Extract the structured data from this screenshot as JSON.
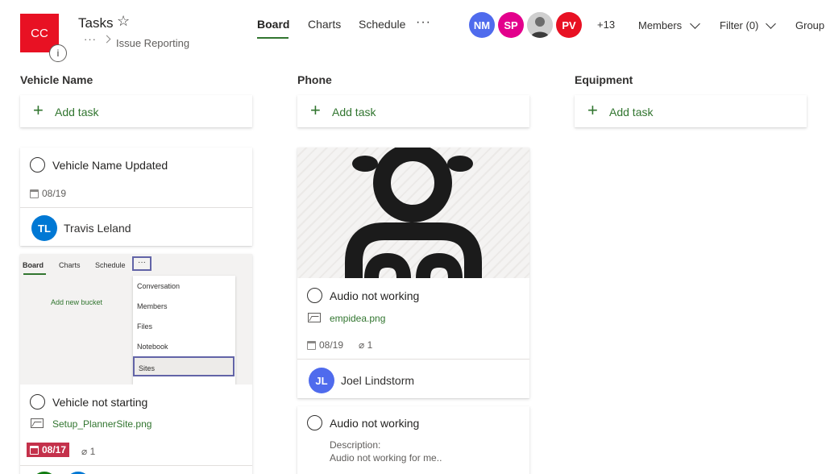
{
  "header": {
    "app_initials": "CC",
    "info_glyph": "i",
    "plan_title": "Tasks",
    "star_glyph": "☆",
    "breadcrumb_more": "···",
    "breadcrumb_label": "Issue Reporting",
    "tabs": [
      {
        "label": "Board",
        "active": true
      },
      {
        "label": "Charts",
        "active": false
      },
      {
        "label": "Schedule",
        "active": false
      }
    ],
    "tab_more": "···",
    "avatars": [
      {
        "initials": "NM",
        "color": "#4f6bed"
      },
      {
        "initials": "SP",
        "color": "#e3008c"
      },
      {
        "initials": "",
        "color": "#d0d0d0"
      },
      {
        "initials": "PV",
        "color": "#e81123"
      }
    ],
    "extra_members": "+13",
    "members_label": "Members",
    "filter_label": "Filter (0)",
    "group_label": "Group"
  },
  "buckets": [
    {
      "title": "Vehicle Name",
      "add_task": "Add task"
    },
    {
      "title": "Phone",
      "add_task": "Add task"
    },
    {
      "title": "Equipment",
      "add_task": "Add task"
    }
  ],
  "add_icon": "+",
  "cards": {
    "vehicle_updated": {
      "title": "Vehicle Name Updated",
      "date": "08/19",
      "assignee_initials": "TL",
      "assignee_name": "Travis Leland",
      "assignee_color": "#0078d4"
    },
    "vehicle_not_starting": {
      "preview": {
        "tabs": [
          "Board",
          "Charts",
          "Schedule"
        ],
        "more": "···",
        "add_bucket": "Add new bucket",
        "menu": [
          "Conversation",
          "Members",
          "Files",
          "Notebook",
          "Sites"
        ]
      },
      "title": "Vehicle not starting",
      "attachment": "Setup_PlannerSite.png",
      "date": "08/17",
      "date_color": "#c4314b",
      "attachment_count": "1"
    },
    "audio_1": {
      "title": "Audio not working",
      "attachment": "empidea.png",
      "date": "08/19",
      "attachment_count": "1",
      "assignee_initials": "JL",
      "assignee_name": "Joel Lindstorm",
      "assignee_color": "#4f6bed"
    },
    "audio_2": {
      "title": "Audio not working",
      "description_label": "Description:",
      "description_text": "Audio not working for me.."
    }
  },
  "colors": {
    "accent_green": "#31752f",
    "tile_red": "#e81123",
    "highlight_purple": "#6264a7"
  }
}
